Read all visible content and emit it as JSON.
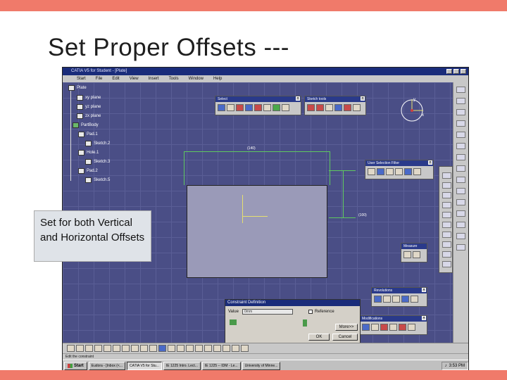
{
  "slide": {
    "title": "Set Proper Offsets ---",
    "callout": "Set for both Vertical and Horizontal Offsets",
    "colors": {
      "band": "#f07a6a",
      "viewport": "#4a4e86",
      "titlebar": "#1a2c7a"
    }
  },
  "app": {
    "window_title": "CATIA V5 for Student - [Plate]",
    "menu": [
      "Start",
      "File",
      "Edit",
      "View",
      "Insert",
      "Tools",
      "Window",
      "Help"
    ]
  },
  "tree": {
    "root": "Plate",
    "items": [
      "xy plane",
      "yz plane",
      "zx plane",
      "PartBody",
      "Pad.1",
      "Sketch.2",
      "Hole.1",
      "Sketch.3",
      "Pad.2",
      "Sketch.5"
    ]
  },
  "dimensions": {
    "horizontal": "(140)",
    "vertical": "(100)"
  },
  "compass": {
    "y": "y",
    "x": "x"
  },
  "toolbars": {
    "select": "Select",
    "sketch_tools": "Sketch tools",
    "user_selection_filter": "User Selection Filter",
    "measure": "Measure",
    "revolutions": "Revolutions",
    "modifications": "Modifications"
  },
  "dialog": {
    "title": "Constraint Definition",
    "value_label": "Value",
    "value": "0mm",
    "reference_label": "Reference",
    "more_button": "More>>",
    "ok_button": "OK",
    "cancel_button": "Cancel"
  },
  "status_bar": "Edit the constraint",
  "taskbar": {
    "start": "Start",
    "tasks": [
      "Eudora - [Inbox (<...",
      "CATIA V5 for Stu...",
      "IE 1225 Intro. Lect...",
      "IE 1225 -- IDM - Le...",
      "University of Minne..."
    ],
    "clock": "3:53 PM"
  }
}
